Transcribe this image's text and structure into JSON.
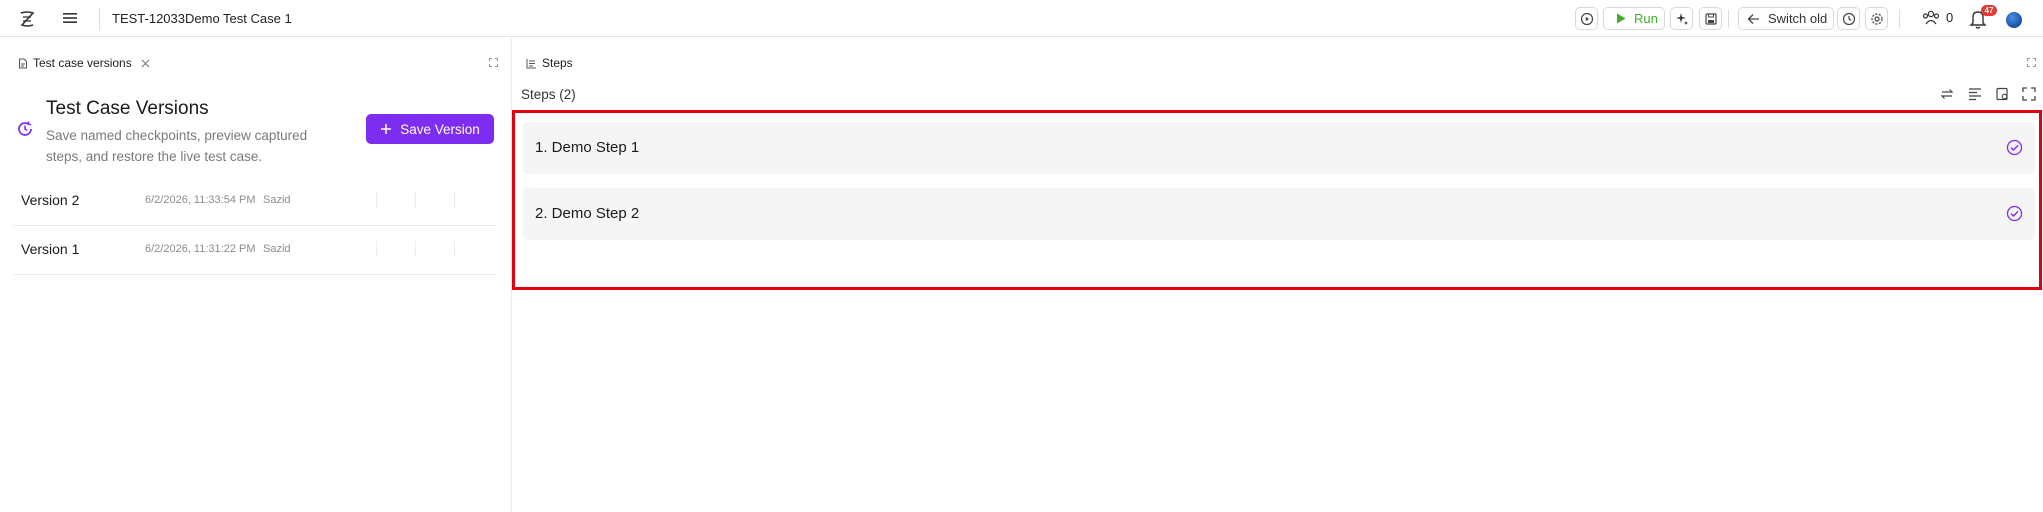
{
  "header": {
    "test_id": "TEST-12033",
    "test_title": "Demo Test Case 1",
    "run_label": "Run",
    "switch_label": "Switch old",
    "team_count": "0",
    "notification_count": "47"
  },
  "left_panel": {
    "tab_label": "Test case versions",
    "title": "Test Case Versions",
    "description": "Save named checkpoints, preview captured steps, and restore the live test case.",
    "save_button": "Save Version",
    "versions": [
      {
        "name": "Version 2",
        "date": "6/2/2026, 11:33:54 PM",
        "user": "Sazid"
      },
      {
        "name": "Version 1",
        "date": "6/2/2026, 11:31:22 PM",
        "user": "Sazid"
      }
    ]
  },
  "right_panel": {
    "tab_label": "Steps",
    "steps_count": "Steps (2)",
    "steps": [
      {
        "label": "1. Demo Step 1"
      },
      {
        "label": "2. Demo Step 2"
      }
    ]
  },
  "colors": {
    "accent": "#7c2df0",
    "run_green": "#3fae28",
    "highlight_red": "#e1000f",
    "badge_red": "#e53935"
  },
  "icons": [
    "logo-icon",
    "menu-icon",
    "play-circle-icon",
    "play-icon",
    "ai-sparkle-icon",
    "save-icon",
    "arrow-left-icon",
    "history-icon",
    "settings-icon",
    "team-icon",
    "bell-icon",
    "avatar",
    "document-icon",
    "close-icon",
    "expand-icon",
    "history-icon",
    "plus-icon",
    "steps-icon",
    "swap-icon",
    "align-icon",
    "bookmark-icon",
    "fullscreen-icon",
    "check-circle-icon"
  ]
}
